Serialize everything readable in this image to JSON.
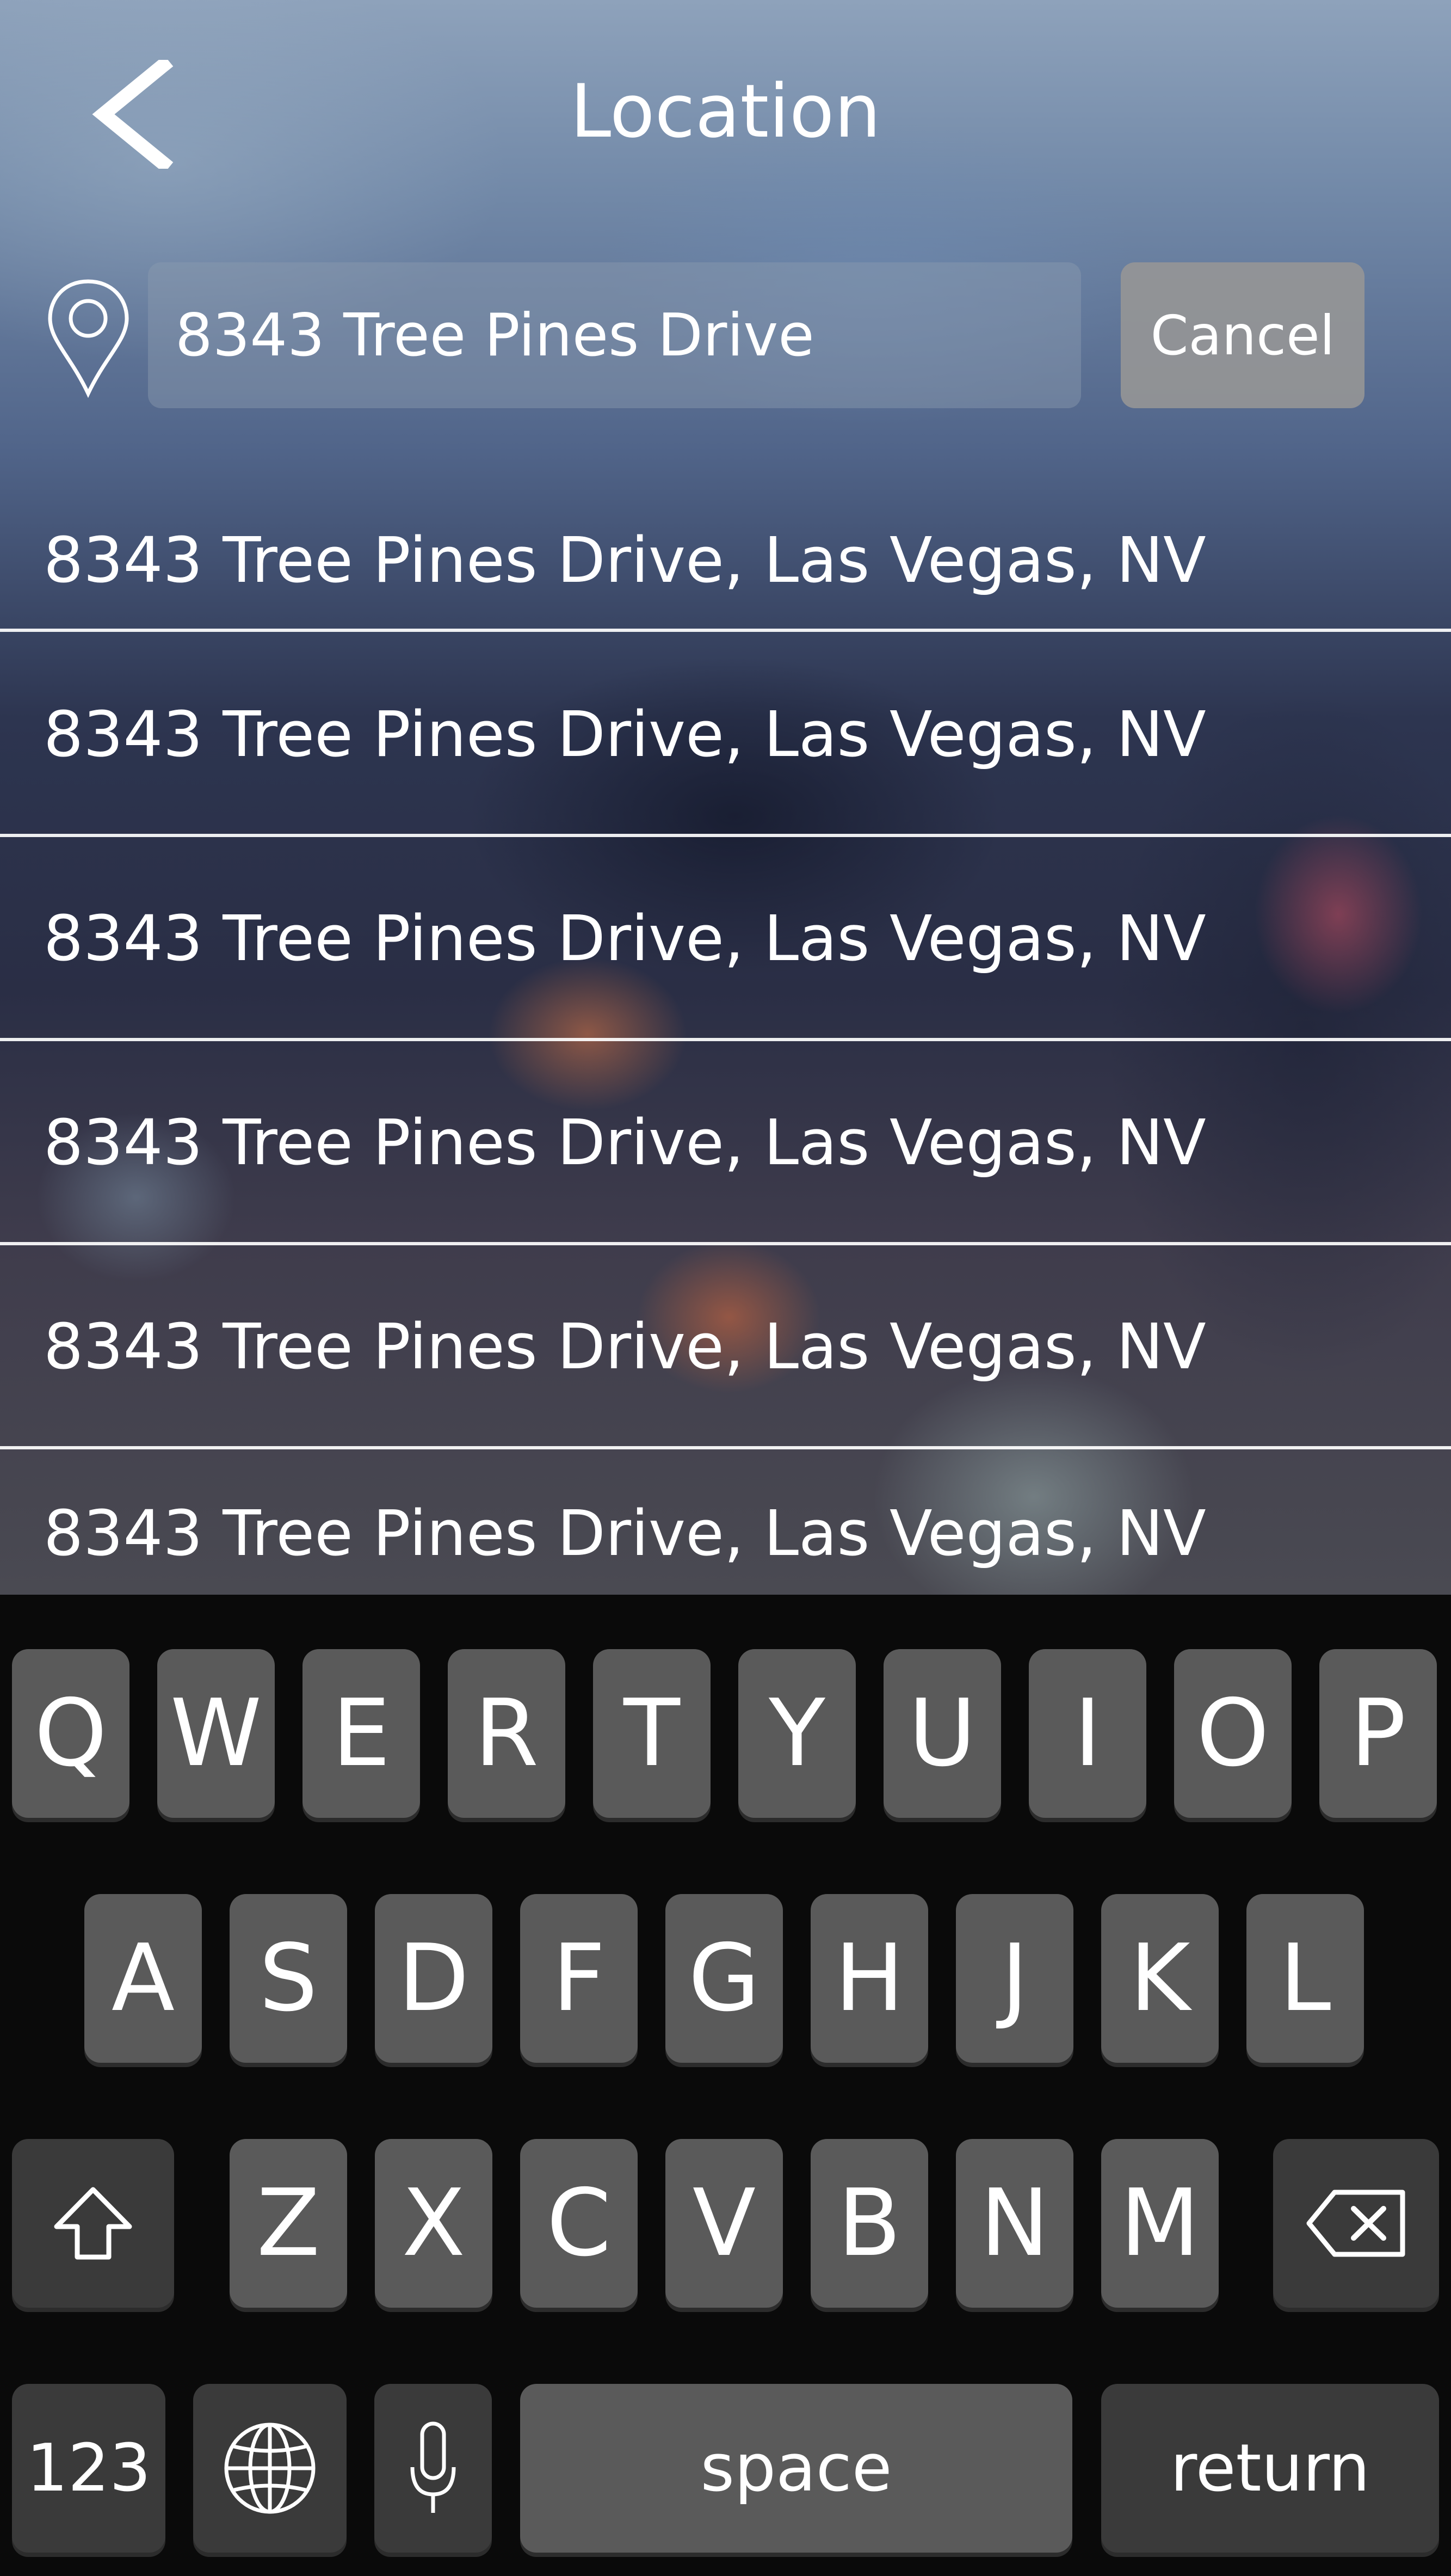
{
  "header": {
    "title": "Location",
    "back_icon": "chevron-left-icon"
  },
  "search": {
    "value": "8343 Tree Pines Drive",
    "placeholder": "",
    "pin_icon": "location-pin-icon",
    "cancel_label": "Cancel"
  },
  "results": [
    "8343 Tree Pines Drive, Las Vegas, NV",
    "8343 Tree Pines Drive, Las Vegas, NV",
    "8343 Tree Pines Drive, Las Vegas, NV",
    "8343 Tree Pines Drive, Las Vegas, NV",
    "8343 Tree Pines Drive, Las Vegas, NV",
    "8343 Tree Pines Drive, Las Vegas, NV"
  ],
  "keyboard": {
    "row1": [
      "Q",
      "W",
      "E",
      "R",
      "T",
      "Y",
      "U",
      "I",
      "O",
      "P"
    ],
    "row2": [
      "A",
      "S",
      "D",
      "F",
      "G",
      "H",
      "J",
      "K",
      "L"
    ],
    "row3": [
      "Z",
      "X",
      "C",
      "V",
      "B",
      "N",
      "M"
    ],
    "numbers_label": "123",
    "space_label": "space",
    "return_label": "return",
    "shift_icon": "shift-arrow-icon",
    "delete_icon": "backspace-icon",
    "globe_icon": "globe-icon",
    "mic_icon": "microphone-icon"
  },
  "colors": {
    "key_light": "#5a5a5a",
    "key_dark": "#3a3a3a",
    "keyboard_bg": "#0a0a0a",
    "cancel_bg": "#969696"
  }
}
